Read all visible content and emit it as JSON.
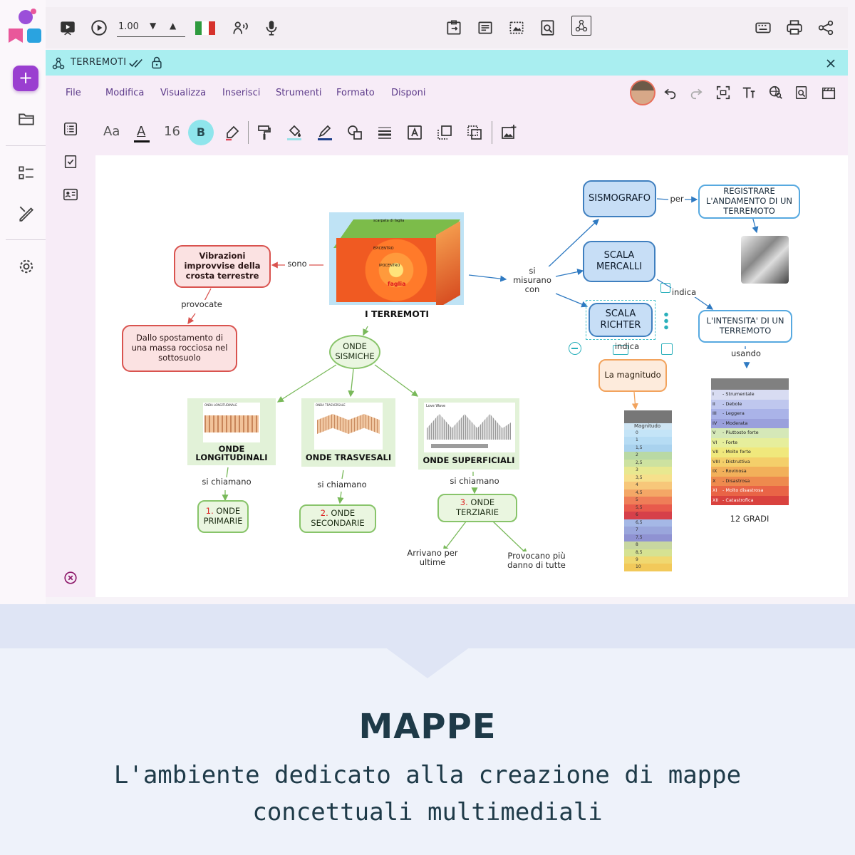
{
  "topbar": {
    "speed": "1.00"
  },
  "document": {
    "title": "TERREMOTI"
  },
  "menu": [
    "File",
    "Modifica",
    "Visualizza",
    "Inserisci",
    "Strumenti",
    "Formato",
    "Disponi"
  ],
  "format": {
    "font_label": "Aa",
    "font_size": "16",
    "bold_label": "B"
  },
  "map": {
    "center_caption": "I TERREMOTI",
    "image_labels": {
      "scarpata": "scarpata di faglia",
      "epicentro": "EPICENTRO",
      "ipocentro": "IPOCENTRO",
      "faglia": "faglia"
    },
    "vibrazioni": "Vibrazioni improvvise della crosta terrestre",
    "sono": "sono",
    "provocate": "provocate",
    "spostamento": "Dallo spostamento di una massa rocciosa nel sottosuolo",
    "si_misurano": "si misurano con",
    "sismografo": "SISMOGRAFO",
    "per": "per",
    "registrare": "REGISTRARE L'ANDAMENTO DI UN TERREMOTO",
    "mercalli": "SCALA MERCALLI",
    "indica1": "indica",
    "intensita": "L'INTENSITA' DI UN TERREMOTO",
    "usando": "usando",
    "richter": "SCALA RICHTER",
    "indica2": "indica",
    "magnitudo": "La magnitudo",
    "dodici_gradi": "12 GRADI",
    "onde_sismiche": "ONDE SISMICHE",
    "long_caption": "ONDE LONGITUDINALI",
    "trasv_caption": "ONDE TRASVESALI",
    "superf_caption": "ONDE SUPERFICIALI",
    "long_img_title": "ONDA LONGITUDINALE",
    "trasv_img_title": "ONDA TRASVERSALE",
    "superf_img_title": "Love Wave",
    "si_chiamano": "si chiamano",
    "primarie_num": "1.",
    "primarie": "ONDE PRIMARIE",
    "secondarie_num": "2.",
    "secondarie": "ONDE SECONDARIE",
    "terziarie_num": "3.",
    "terziarie": "ONDE TERZIARIE",
    "arrivano": "Arrivano per ultime",
    "provocano": "Provocano più danno di tutte",
    "magnitudo_table": {
      "header": "Magnitudo",
      "rows": [
        "0",
        "1",
        "1,5",
        "2",
        "2,5",
        "3",
        "3,5",
        "4",
        "4,5",
        "5",
        "5,5",
        "6",
        "6,5",
        "7",
        "7,5",
        "8",
        "8,5",
        "9",
        "10"
      ]
    },
    "mercalli_table": {
      "rows": [
        {
          "n": "I",
          "t": "- Strumentale"
        },
        {
          "n": "II",
          "t": "- Debole"
        },
        {
          "n": "III",
          "t": "- Leggera"
        },
        {
          "n": "IV",
          "t": "- Moderata"
        },
        {
          "n": "V",
          "t": "- Piuttosto forte"
        },
        {
          "n": "VI",
          "t": "- Forte"
        },
        {
          "n": "VII",
          "t": "- Molto forte"
        },
        {
          "n": "VIII",
          "t": "- Distruttiva"
        },
        {
          "n": "IX",
          "t": "- Rovinosa"
        },
        {
          "n": "X",
          "t": "- Disastrosa"
        },
        {
          "n": "XI",
          "t": "- Molto disastrosa"
        },
        {
          "n": "XII",
          "t": "- Catastrofica"
        }
      ]
    }
  },
  "footer": {
    "headline": "MAPPE",
    "subline": "L'ambiente dedicato alla creazione di mappe concettuali multimediali"
  },
  "colors": {
    "accent": "#9a3fd0",
    "docbar": "#a9eef0",
    "menu_text": "#5d3b8a",
    "headline": "#1e3a48"
  }
}
